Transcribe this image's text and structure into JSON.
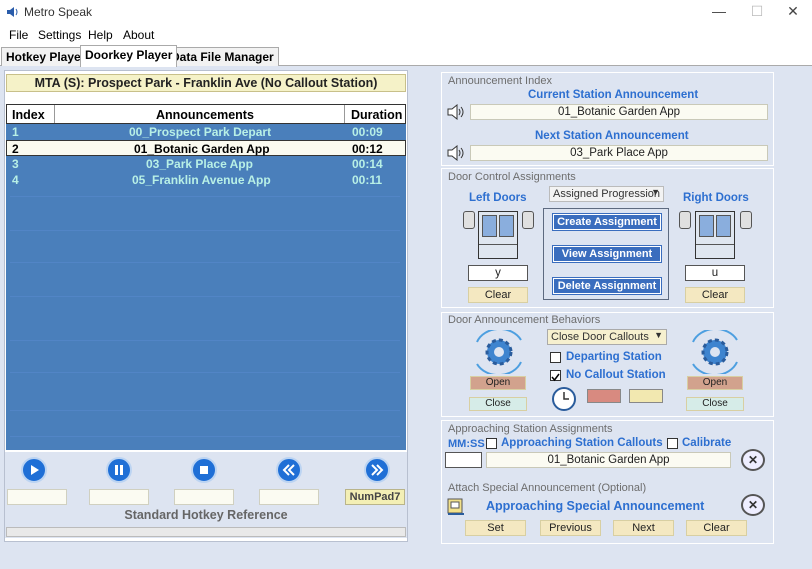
{
  "window": {
    "title": "Metro Speak",
    "minimize": "—",
    "maximize": "☐",
    "close": "✕"
  },
  "menu": [
    "File",
    "Settings",
    "Help",
    "About"
  ],
  "tabs": [
    "Hotkey Player",
    "Doorkey Player",
    "Data File Manager"
  ],
  "route": "MTA (S): Prospect Park - Franklin Ave (No Callout Station)",
  "table": {
    "headers": [
      "Index",
      "Announcements",
      "Duration"
    ],
    "rows": [
      {
        "index": "1",
        "name": "00_Prospect Park Depart",
        "duration": "00:09"
      },
      {
        "index": "2",
        "name": "01_Botanic Garden App",
        "duration": "00:12"
      },
      {
        "index": "3",
        "name": "03_Park Place App",
        "duration": "00:14"
      },
      {
        "index": "4",
        "name": "05_Franklin Avenue App",
        "duration": "00:11"
      }
    ],
    "selected": 1
  },
  "player": {
    "numpad": "NumPad7",
    "std_ref": "Standard Hotkey Reference"
  },
  "announcement_index": {
    "title": "Announcement Index",
    "current_label": "Current Station Announcement",
    "current_value": "01_Botanic Garden App",
    "next_label": "Next Station Announcement",
    "next_value": "03_Park Place App"
  },
  "door_control": {
    "title": "Door Control Assignments",
    "left_label": "Left Doors",
    "right_label": "Right Doors",
    "dropdown": "Assigned Progression",
    "left_key": "y",
    "right_key": "u",
    "clear": "Clear",
    "create": "Create Assignment",
    "view": "View Assignment",
    "delete": "Delete Assignment"
  },
  "door_behaviors": {
    "title": "Door Announcement Behaviors",
    "dropdown": "Close Door Callouts",
    "departing": "Departing Station",
    "no_callout": "No Callout Station",
    "departing_checked": false,
    "no_callout_checked": true,
    "open": "Open",
    "close": "Close",
    "color_red": "#d88a80",
    "color_yellow": "#f2e8b0"
  },
  "approaching": {
    "title": "Approaching Station Assignments",
    "mmss": "MM:SS",
    "callouts": "Approaching Station Callouts",
    "calibrate": "Calibrate",
    "time_value": "",
    "announcement": "01_Botanic Garden App"
  },
  "special": {
    "title": "Attach Special Announcement (Optional)",
    "label": "Approaching Special Announcement",
    "set": "Set",
    "previous": "Previous",
    "next": "Next",
    "clear": "Clear"
  },
  "colors": {
    "accent": "#2d6fd0",
    "list_bg": "#4a7fbb",
    "panel": "#dde4f1"
  }
}
